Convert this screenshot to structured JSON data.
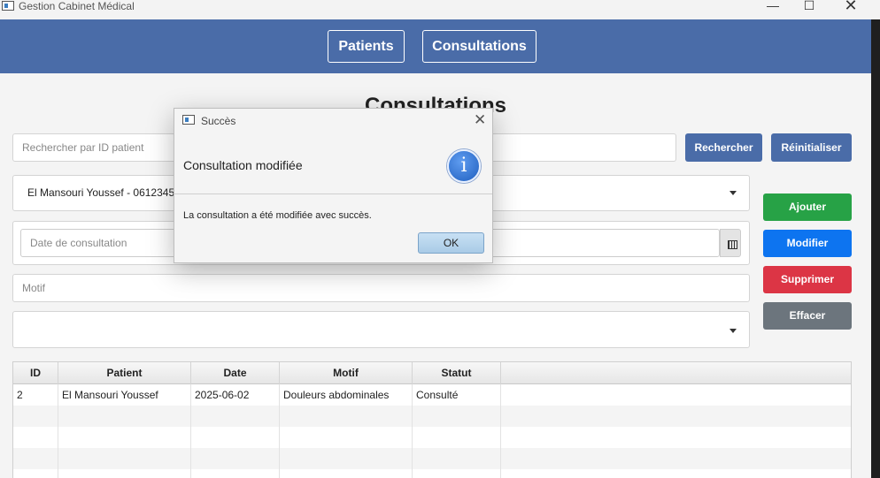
{
  "window": {
    "title": "Gestion Cabinet Médical",
    "min_glyph": "—",
    "max_glyph": "☐",
    "close_glyph": "✕"
  },
  "nav": {
    "patients": "Patients",
    "consultations": "Consultations"
  },
  "page": {
    "title": "Consultations"
  },
  "search": {
    "placeholder": "Rechercher par ID patient",
    "search_btn": "Rechercher",
    "reset_btn": "Réinitialiser"
  },
  "form": {
    "patient_value": "El Mansouri Youssef - 06123456",
    "date_placeholder": "Date de consultation",
    "motif_placeholder": "Motif",
    "status_value": ""
  },
  "actions": {
    "add": "Ajouter",
    "modify": "Modifier",
    "delete": "Supprimer",
    "clear": "Effacer"
  },
  "table": {
    "headers": [
      "ID",
      "Patient",
      "Date",
      "Motif",
      "Statut"
    ],
    "rows": [
      [
        "2",
        "El Mansouri Youssef",
        "2025-06-02",
        "Douleurs abdominales",
        "Consulté"
      ]
    ]
  },
  "dialog": {
    "title": "Succès",
    "close_glyph": "✕",
    "header": "Consultation modifiée",
    "icon_glyph": "i",
    "message": "La consultation a été modifiée avec succès.",
    "ok": "OK"
  },
  "colors": {
    "nav": "#4a6ca8",
    "add": "#27a246",
    "modify": "#0d74f0",
    "delete": "#dc3545",
    "clear": "#6c757d"
  }
}
